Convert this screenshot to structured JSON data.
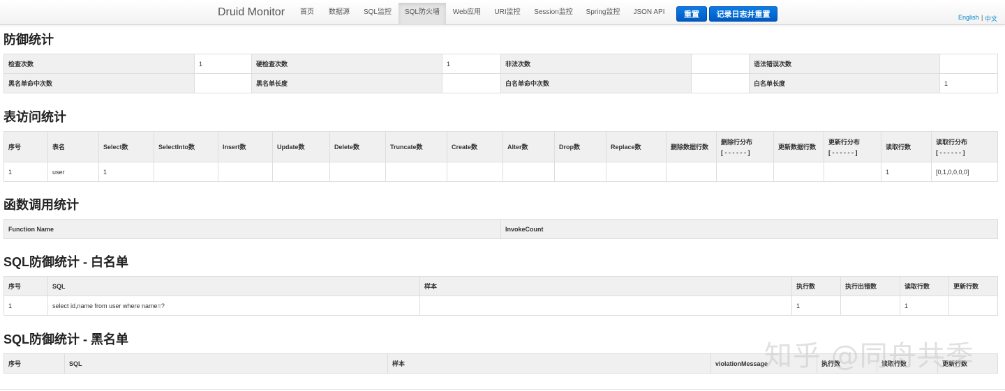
{
  "navbar": {
    "brand": "Druid Monitor",
    "items": [
      {
        "label": "首页"
      },
      {
        "label": "数据源"
      },
      {
        "label": "SQL监控"
      },
      {
        "label": "SQL防火墙"
      },
      {
        "label": "Web应用"
      },
      {
        "label": "URI监控"
      },
      {
        "label": "Session监控"
      },
      {
        "label": "Spring监控"
      },
      {
        "label": "JSON API"
      }
    ],
    "reset_label": "重置",
    "log_reset_label": "记录日志并重置",
    "lang_en": "English",
    "lang_sep": "|",
    "lang_zh": "中文"
  },
  "defense": {
    "title": "防御统计",
    "row1": [
      {
        "label": "检查次数",
        "value": "1"
      },
      {
        "label": "硬检查次数",
        "value": "1"
      },
      {
        "label": "非法次数",
        "value": ""
      },
      {
        "label": "语法错误次数",
        "value": ""
      }
    ],
    "row2": [
      {
        "label": "黑名单命中次数",
        "value": ""
      },
      {
        "label": "黑名单长度",
        "value": ""
      },
      {
        "label": "白名单命中次数",
        "value": ""
      },
      {
        "label": "白名单长度",
        "value": "1"
      }
    ]
  },
  "table_access": {
    "title": "表访问统计",
    "headers": [
      "序号",
      "表名",
      "Select数",
      "SelectInto数",
      "Insert数",
      "Update数",
      "Delete数",
      "Truncate数",
      "Create数",
      "Alter数",
      "Drop数",
      "Replace数",
      "删除数据行数",
      "删除行分布",
      "更新数据行数",
      "更新行分布",
      "读取行数",
      "读取行分布"
    ],
    "dist_sub": "[ - - - - - - ]",
    "rows": [
      [
        "1",
        "user",
        "1",
        "",
        "",
        "",
        "",
        "",
        "",
        "",
        "",
        "",
        "",
        "",
        "",
        "",
        "1",
        "[0,1,0,0,0,0]"
      ]
    ]
  },
  "functions": {
    "title": "函数调用统计",
    "headers": [
      "Function Name",
      "InvokeCount"
    ]
  },
  "whitelist": {
    "title": "SQL防御统计 - 白名单",
    "headers": [
      "序号",
      "SQL",
      "样本",
      "执行数",
      "执行出错数",
      "读取行数",
      "更新行数"
    ],
    "rows": [
      [
        "1",
        "select id,name from user where name=?",
        "",
        "1",
        "",
        "1",
        ""
      ]
    ]
  },
  "blacklist": {
    "title": "SQL防御统计 - 黑名单",
    "headers": [
      "序号",
      "SQL",
      "样本",
      "violationMessage",
      "执行数",
      "读取行数",
      "更新行数"
    ]
  },
  "watermark": "知乎 @同舟共季"
}
